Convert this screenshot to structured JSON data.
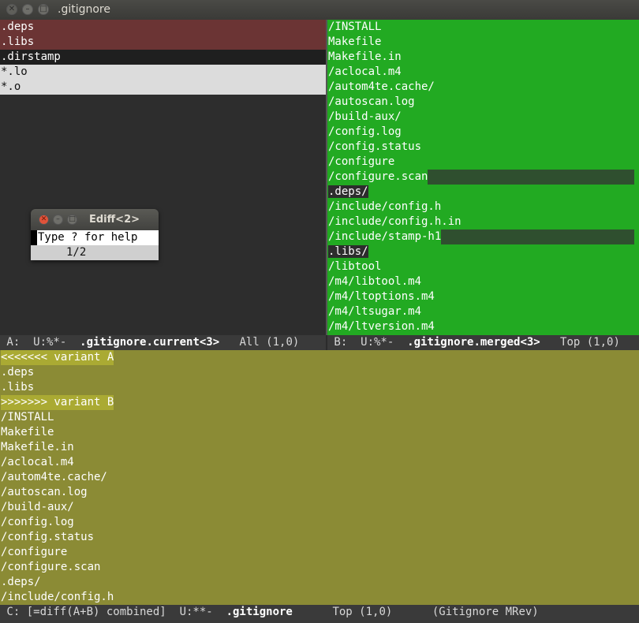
{
  "window": {
    "title": ".gitignore"
  },
  "paneA": {
    "lines": [
      ".deps",
      ".libs",
      ".dirstamp",
      "*.lo",
      "*.o"
    ],
    "modeline": {
      "left": " A:  U:%*-  ",
      "buffer": ".gitignore.current<3>",
      "right": "   All (1,0)"
    }
  },
  "paneB": {
    "lines": [
      "/INSTALL",
      "Makefile",
      "Makefile.in",
      "/aclocal.m4",
      "/autom4te.cache/",
      "/autoscan.log",
      "/build-aux/",
      "/config.log",
      "/config.status",
      "/configure",
      "/configure.scan",
      ".deps/",
      "/include/config.h",
      "/include/config.h.in",
      "/include/stamp-h1",
      ".libs/",
      "/libtool",
      "/m4/libtool.m4",
      "/m4/ltoptions.m4",
      "/m4/ltsugar.m4",
      "/m4/ltversion.m4"
    ],
    "modeline": {
      "left": " B:  U:%*-  ",
      "buffer": ".gitignore.merged<3>",
      "right": "   Top (1,0)"
    }
  },
  "paneC": {
    "variant_a": "<<<<<<< variant A",
    "variant_b": ">>>>>>> variant B",
    "lines_a": [
      ".deps",
      ".libs"
    ],
    "lines_b": [
      "/INSTALL",
      "Makefile",
      "Makefile.in",
      "/aclocal.m4",
      "/autom4te.cache/",
      "/autoscan.log",
      "/build-aux/",
      "/config.log",
      "/config.status",
      "/configure",
      "/configure.scan",
      ".deps/",
      "/include/config.h"
    ],
    "modeline": {
      "left": " C: [=diff(A+B) combined]  U:**-  ",
      "buffer": ".gitignore",
      "right": "      Top (1,0)      (Gitignore MRev)"
    }
  },
  "popup": {
    "title": "Ediff<2>",
    "help": "Type ? for help",
    "count": "1/2"
  },
  "colors": {
    "paneB_bg": "#22aa22",
    "paneC_bg": "#8b8b35",
    "diff_a_bg": "#6b3434"
  }
}
